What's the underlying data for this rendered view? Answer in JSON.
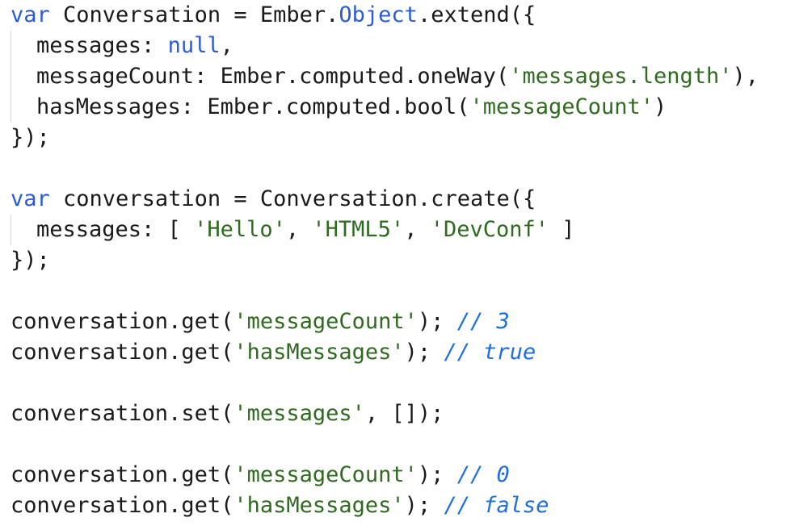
{
  "lines": [
    {
      "indent": false,
      "tokens": [
        {
          "t": "kw",
          "v": "var"
        },
        {
          "t": "p",
          "v": " Conversation = Ember."
        },
        {
          "t": "kw",
          "v": "Object"
        },
        {
          "t": "p",
          "v": ".extend({"
        }
      ]
    },
    {
      "indent": true,
      "tokens": [
        {
          "t": "p",
          "v": "messages: "
        },
        {
          "t": "kw",
          "v": "null"
        },
        {
          "t": "p",
          "v": ","
        }
      ]
    },
    {
      "indent": true,
      "tokens": [
        {
          "t": "p",
          "v": "messageCount: Ember.computed.oneWay("
        },
        {
          "t": "str",
          "v": "'messages.length'"
        },
        {
          "t": "p",
          "v": "),"
        }
      ]
    },
    {
      "indent": true,
      "tokens": [
        {
          "t": "p",
          "v": "hasMessages: Ember.computed.bool("
        },
        {
          "t": "str",
          "v": "'messageCount'"
        },
        {
          "t": "p",
          "v": ")"
        }
      ]
    },
    {
      "indent": false,
      "tokens": [
        {
          "t": "p",
          "v": "});"
        }
      ]
    },
    {
      "blank": true
    },
    {
      "indent": false,
      "tokens": [
        {
          "t": "kw",
          "v": "var"
        },
        {
          "t": "p",
          "v": " conversation = Conversation.create({"
        }
      ]
    },
    {
      "indent": true,
      "tokens": [
        {
          "t": "p",
          "v": "messages: [ "
        },
        {
          "t": "str",
          "v": "'Hello'"
        },
        {
          "t": "p",
          "v": ", "
        },
        {
          "t": "str",
          "v": "'HTML5'"
        },
        {
          "t": "p",
          "v": ", "
        },
        {
          "t": "str",
          "v": "'DevConf'"
        },
        {
          "t": "p",
          "v": " ]"
        }
      ]
    },
    {
      "indent": false,
      "tokens": [
        {
          "t": "p",
          "v": "});"
        }
      ]
    },
    {
      "blank": true
    },
    {
      "indent": false,
      "tokens": [
        {
          "t": "p",
          "v": "conversation.get("
        },
        {
          "t": "str",
          "v": "'messageCount'"
        },
        {
          "t": "p",
          "v": "); "
        },
        {
          "t": "cm",
          "v": "// 3"
        }
      ]
    },
    {
      "indent": false,
      "tokens": [
        {
          "t": "p",
          "v": "conversation.get("
        },
        {
          "t": "str",
          "v": "'hasMessages'"
        },
        {
          "t": "p",
          "v": "); "
        },
        {
          "t": "cm",
          "v": "// true"
        }
      ]
    },
    {
      "blank": true
    },
    {
      "indent": false,
      "tokens": [
        {
          "t": "p",
          "v": "conversation.set("
        },
        {
          "t": "str",
          "v": "'messages'"
        },
        {
          "t": "p",
          "v": ", []);"
        }
      ]
    },
    {
      "blank": true
    },
    {
      "indent": false,
      "tokens": [
        {
          "t": "p",
          "v": "conversation.get("
        },
        {
          "t": "str",
          "v": "'messageCount'"
        },
        {
          "t": "p",
          "v": "); "
        },
        {
          "t": "cm",
          "v": "// 0"
        }
      ]
    },
    {
      "indent": false,
      "tokens": [
        {
          "t": "p",
          "v": "conversation.get("
        },
        {
          "t": "str",
          "v": "'hasMessages'"
        },
        {
          "t": "p",
          "v": "); "
        },
        {
          "t": "cm",
          "v": "// false"
        }
      ]
    }
  ],
  "colors": {
    "keyword": "#2a5bd7",
    "string": "#2f6b1f",
    "comment": "#1f6fe0",
    "plain": "#1a1a1a"
  }
}
